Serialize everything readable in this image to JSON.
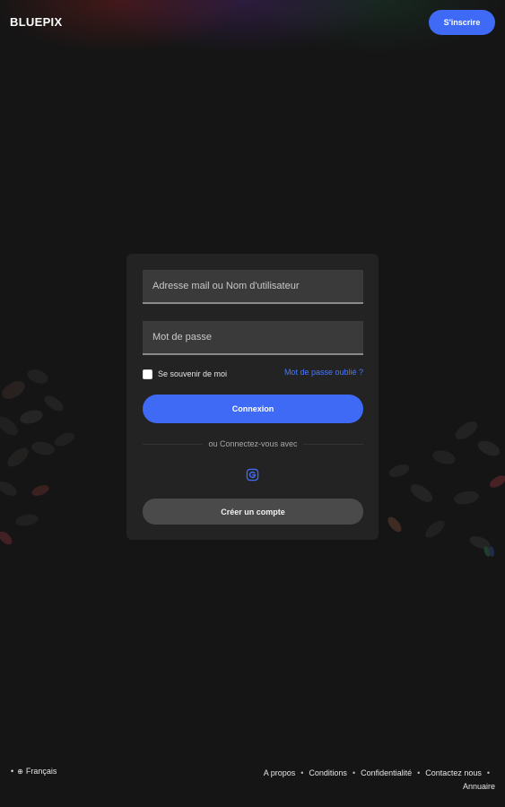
{
  "header": {
    "logo": "BLUEPIX",
    "signup_label": "S'inscrire"
  },
  "login_form": {
    "email_placeholder": "Adresse mail ou Nom d'utilisateur",
    "password_placeholder": "Mot de passe",
    "remember_label": "Se souvenir de moi",
    "remember_checked": false,
    "forgot_label": "Mot de passe oublié ?",
    "login_label": "Connexion",
    "divider_text": "ou Connectez-vous avec",
    "social_icon": "google-icon",
    "create_account_label": "Créer un compte"
  },
  "footer": {
    "bullet": "•",
    "language_icon": "globe-icon",
    "language": "Français",
    "links": [
      "A propos",
      "Conditions",
      "Confidentialité",
      "Contactez nous",
      "Annuaire"
    ]
  },
  "colors": {
    "accent": "#3f6af5",
    "background": "#151515",
    "card": "#232323",
    "link": "#4a78ff"
  }
}
